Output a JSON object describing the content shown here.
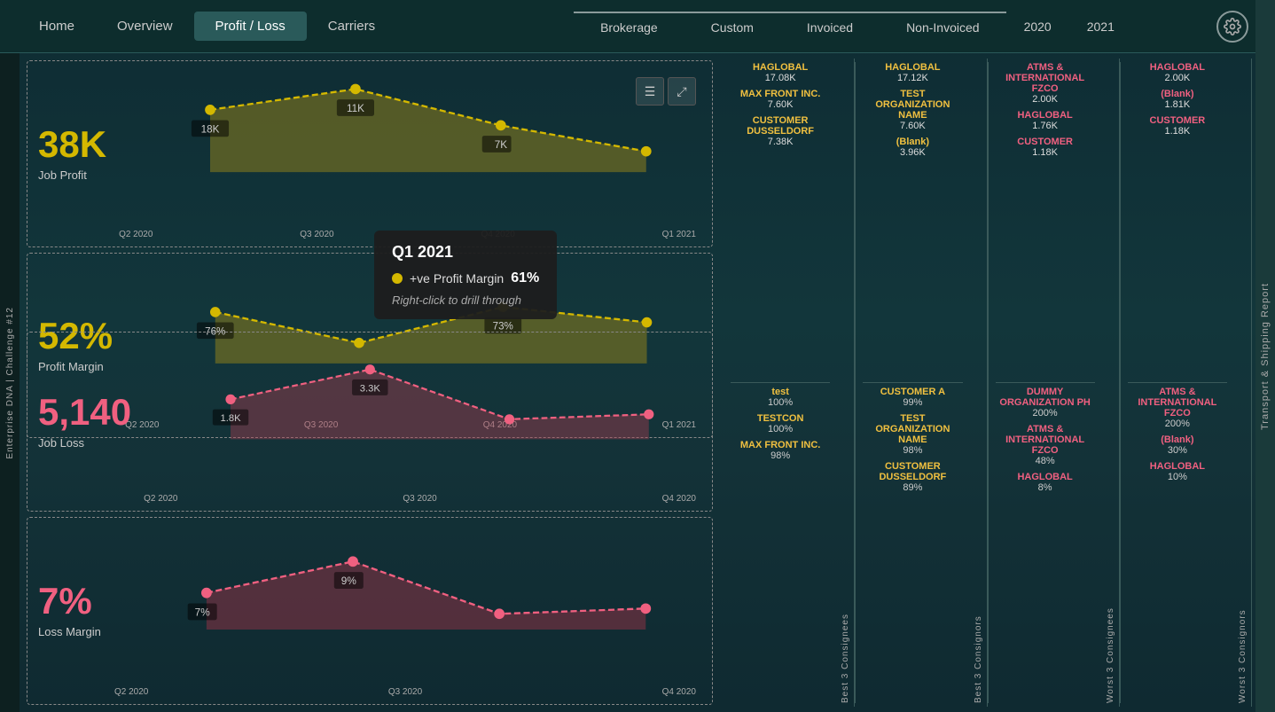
{
  "nav": {
    "items": [
      {
        "label": "Home",
        "active": false
      },
      {
        "label": "Overview",
        "active": false
      },
      {
        "label": "Profit / Loss",
        "active": true
      },
      {
        "label": "Carriers",
        "active": false
      }
    ],
    "right_items": [
      {
        "label": "Brokerage",
        "underline": true
      },
      {
        "label": "Custom",
        "underline": true
      },
      {
        "label": "Invoiced",
        "underline": true
      },
      {
        "label": "Non-Invoiced",
        "underline": true
      },
      {
        "label": "2020",
        "underline": false
      },
      {
        "label": "2021",
        "underline": false
      }
    ],
    "icon_label": "⚙"
  },
  "side_label_right": "Transport & Shipping Report",
  "side_label_left": "Enterprise DNA\nChallenge #12",
  "profit_section": {
    "value": "38K",
    "label": "Job Profit",
    "chart_points": [
      {
        "x": 0,
        "y": 60,
        "label": "18K",
        "quarter": "Q2 2020"
      },
      {
        "x": 1,
        "y": 90,
        "label": "11K",
        "quarter": "Q3 2020"
      },
      {
        "x": 2,
        "y": 75,
        "label": "7K",
        "quarter": "Q4 2020"
      },
      {
        "x": 3,
        "y": 50,
        "label": "",
        "quarter": "Q1 2021"
      }
    ]
  },
  "margin_section": {
    "value": "52%",
    "label": "Profit Margin",
    "chart_points": [
      {
        "x": 0,
        "y": 65,
        "label": "76%",
        "quarter": "Q2 2020"
      },
      {
        "x": 1,
        "y": 45,
        "label": "",
        "quarter": "Q3 2020"
      },
      {
        "x": 2,
        "y": 62,
        "label": "73%",
        "quarter": "Q4 2020"
      },
      {
        "x": 3,
        "y": 55,
        "label": "61%",
        "quarter": "Q1 2021"
      }
    ]
  },
  "loss_section": {
    "value": "5,140",
    "label": "Job Loss",
    "chart_points": [
      {
        "x": 0,
        "y": 55,
        "label": "1.8K",
        "quarter": "Q2 2020"
      },
      {
        "x": 1,
        "y": 75,
        "label": "3.3K",
        "quarter": "Q3 2020"
      },
      {
        "x": 2,
        "y": 40,
        "label": "",
        "quarter": "Q4 2020"
      }
    ]
  },
  "loss_margin_section": {
    "value": "7%",
    "label": "Loss Margin",
    "chart_points": [
      {
        "x": 0,
        "y": 50,
        "label": "7%",
        "quarter": "Q2 2020"
      },
      {
        "x": 1,
        "y": 70,
        "label": "9%",
        "quarter": "Q3 2020"
      },
      {
        "x": 2,
        "y": 35,
        "label": "",
        "quarter": "Q4 2020"
      }
    ]
  },
  "tooltip": {
    "title": "Q1 2021",
    "label": "+ve Profit Margin",
    "value": "61%",
    "hint": "Right-click to drill through"
  },
  "best_consignees": {
    "title": "Best 3 Consignees",
    "items": [
      {
        "name": "HAGLOBAL",
        "value": "17.08K"
      },
      {
        "name": "MAX FRONT INC.",
        "value": "7.60K"
      },
      {
        "name": "CUSTOMER DUSSELDORF",
        "value": "7.38K"
      },
      {
        "name": "test",
        "value": "100%"
      },
      {
        "name": "TESTCON",
        "value": "100%"
      },
      {
        "name": "MAX FRONT INC.",
        "value": "98%"
      }
    ]
  },
  "best_consignors": {
    "title": "Best 3 Consignors",
    "items": [
      {
        "name": "HAGLOBAL",
        "value": "17.12K"
      },
      {
        "name": "TEST ORGANIZATION NAME",
        "value": "7.60K"
      },
      {
        "name": "(Blank)",
        "value": "3.96K"
      },
      {
        "name": "CUSTOMER A",
        "value": "99%"
      },
      {
        "name": "TEST ORGANIZATION NAME",
        "value": "98%"
      },
      {
        "name": "CUSTOMER DUSSELDORF",
        "value": "89%"
      }
    ]
  },
  "worst_consignees": {
    "title": "Worst 3 Consignees",
    "items": [
      {
        "name": "ATMS & INTERNATIONAL FZCO",
        "value": "2.00K"
      },
      {
        "name": "HAGLOBAL",
        "value": "1.76K"
      },
      {
        "name": "CUSTOMER",
        "value": "1.18K"
      },
      {
        "name": "DUMMY ORGANIZATION PH",
        "value": "200%"
      },
      {
        "name": "ATMS & INTERNATIONAL FZCO",
        "value": "48%"
      },
      {
        "name": "HAGLOBAL",
        "value": "8%"
      }
    ]
  },
  "worst_consignors": {
    "title": "Worst 3 Consignors",
    "items": [
      {
        "name": "HAGLOBAL",
        "value": "2.00K"
      },
      {
        "name": "(Blank)",
        "value": "1.81K"
      },
      {
        "name": "CUSTOMER",
        "value": "1.18K"
      },
      {
        "name": "ATMS & INTERNATIONAL FZCO",
        "value": "200%"
      },
      {
        "name": "(Blank)",
        "value": "30%"
      },
      {
        "name": "HAGLOBAL",
        "value": "10%"
      }
    ]
  }
}
